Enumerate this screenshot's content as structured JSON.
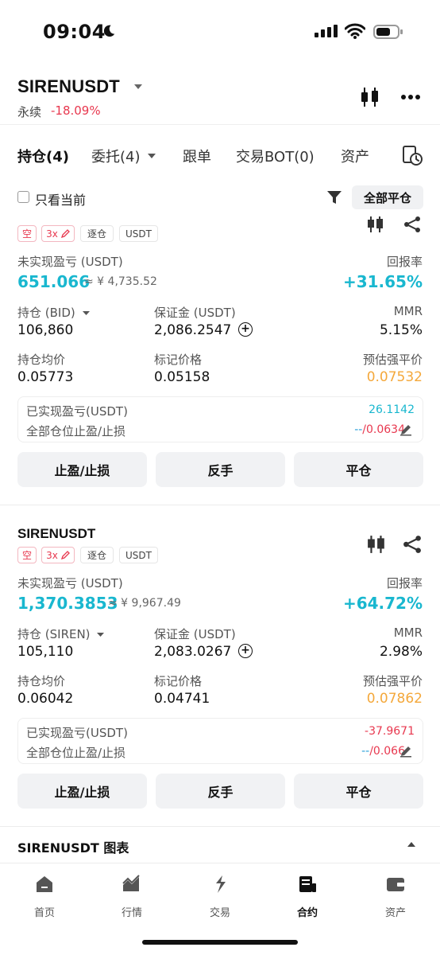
{
  "status_bar": {
    "time": "09:04"
  },
  "header": {
    "pair": "SIRENUSDT",
    "type_label": "永续",
    "change": "-18.09%"
  },
  "tabs": [
    {
      "label": "持仓(4)"
    },
    {
      "label": "委托(4)"
    },
    {
      "label": "跟单"
    },
    {
      "label": "交易BOT(0)"
    },
    {
      "label": "资产"
    }
  ],
  "filter": {
    "only_current": "只看当前",
    "close_all": "全部平仓"
  },
  "positions": [
    {
      "symbol": "",
      "side": "空",
      "leverage": "3x",
      "margin_mode": "逐仓",
      "quote": "USDT",
      "unrealized_label": "未实现盈亏 (USDT)",
      "unrealized": "651.066",
      "unrealized_approx": "≈ ¥ 4,735.52",
      "roe_label": "回报率",
      "roe": "+31.65%",
      "size_label": "持仓 (BID)",
      "size": "106,860",
      "margin_label": "保证金 (USDT)",
      "margin": "2,086.2547",
      "mmr_label": "MMR",
      "mmr": "5.15%",
      "entry_label": "持仓均价",
      "entry": "0.05773",
      "mark_label": "标记价格",
      "mark": "0.05158",
      "liq_label": "预估强平价",
      "liq": "0.07532",
      "realized_label": "已实现盈亏(USDT)",
      "realized": "26.1142",
      "tpsl_label": "全部仓位止盈/止损",
      "tpsl_tp": "--",
      "tpsl_sl": "/0.0634",
      "btn_tpsl": "止盈/止损",
      "btn_reverse": "反手",
      "btn_close": "平仓"
    },
    {
      "symbol": "SIRENUSDT",
      "side": "空",
      "leverage": "3x",
      "margin_mode": "逐仓",
      "quote": "USDT",
      "unrealized_label": "未实现盈亏 (USDT)",
      "unrealized": "1,370.3853",
      "unrealized_approx": "≈ ¥ 9,967.49",
      "roe_label": "回报率",
      "roe": "+64.72%",
      "size_label": "持仓 (SIREN)",
      "size": "105,110",
      "margin_label": "保证金 (USDT)",
      "margin": "2,083.0267",
      "mmr_label": "MMR",
      "mmr": "2.98%",
      "entry_label": "持仓均价",
      "entry": "0.06042",
      "mark_label": "标记价格",
      "mark": "0.04741",
      "liq_label": "预估强平价",
      "liq": "0.07862",
      "realized_label": "已实现盈亏(USDT)",
      "realized": "-37.9671",
      "tpsl_label": "全部仓位止盈/止损",
      "tpsl_tp": "--",
      "tpsl_sl": "/0.066",
      "btn_tpsl": "止盈/止损",
      "btn_reverse": "反手",
      "btn_close": "平仓"
    }
  ],
  "chart_row": {
    "title": "SIRENUSDT  图表"
  },
  "bottom_nav": [
    {
      "label": "首页"
    },
    {
      "label": "行情"
    },
    {
      "label": "交易"
    },
    {
      "label": "合约"
    },
    {
      "label": "资产"
    }
  ],
  "colors": {
    "teal": "#19b7cf",
    "red": "#e8384f",
    "orange": "#f4a83b"
  }
}
